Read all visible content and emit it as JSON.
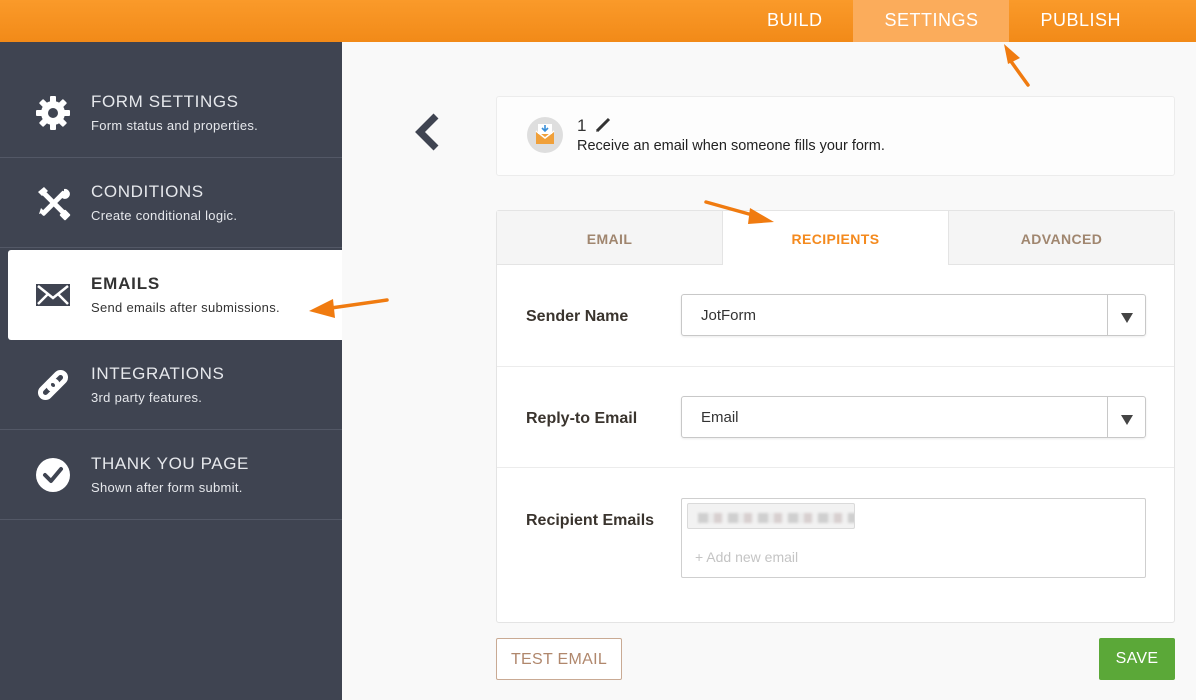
{
  "topnav": {
    "tabs": [
      {
        "label": "BUILD"
      },
      {
        "label": "SETTINGS",
        "active": true
      },
      {
        "label": "PUBLISH"
      }
    ]
  },
  "sidebar": {
    "items": [
      {
        "title": "FORM SETTINGS",
        "subtitle": "Form status and properties.",
        "icon": "gear-icon"
      },
      {
        "title": "CONDITIONS",
        "subtitle": "Create conditional logic.",
        "icon": "tools-icon"
      },
      {
        "title": "EMAILS",
        "subtitle": "Send emails after submissions.",
        "icon": "envelope-icon",
        "active": true
      },
      {
        "title": "INTEGRATIONS",
        "subtitle": "3rd party features.",
        "icon": "link-icon"
      },
      {
        "title": "THANK YOU PAGE",
        "subtitle": "Shown after form submit.",
        "icon": "check-circle-icon"
      }
    ]
  },
  "email_header": {
    "number": "1",
    "description": "Receive an email when someone fills your form."
  },
  "tabs": [
    {
      "label": "EMAIL"
    },
    {
      "label": "RECIPIENTS",
      "active": true
    },
    {
      "label": "ADVANCED"
    }
  ],
  "fields": {
    "sender_name": {
      "label": "Sender Name",
      "value": "JotForm"
    },
    "reply_to": {
      "label": "Reply-to Email",
      "value": "Email"
    },
    "recipients": {
      "label": "Recipient Emails",
      "placeholder": "+ Add new email"
    }
  },
  "buttons": {
    "test_email": "TEST EMAIL",
    "save": "SAVE"
  },
  "colors": {
    "accent": "#f48a1e",
    "sidebar": "#3f4451",
    "save": "#5ba838"
  }
}
